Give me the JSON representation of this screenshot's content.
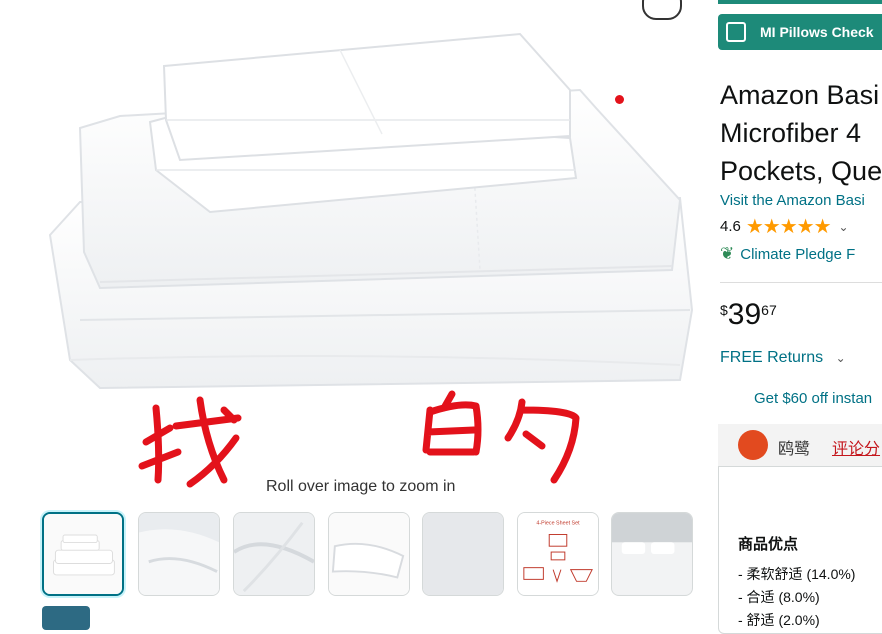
{
  "image": {
    "zoom_hint": "Roll over image to zoom in",
    "alt": "White microfiber sheet set folded and stacked"
  },
  "thumbnails": [
    {
      "label": "sheet-set-stack",
      "selected": true
    },
    {
      "label": "pillowcase-closeup",
      "selected": false
    },
    {
      "label": "sheet-texture",
      "selected": false
    },
    {
      "label": "pillow-side",
      "selected": false
    },
    {
      "label": "fabric-swatch",
      "selected": false
    },
    {
      "label": "4-piece-sheet-set-diagram",
      "selected": false
    },
    {
      "label": "bed-in-room",
      "selected": false
    }
  ],
  "thumb_text": {
    "diagram_title": "4-Piece Sheet Set"
  },
  "annotation": {
    "handwritten": "我 的",
    "color": "#e3121b"
  },
  "extension": {
    "button_label": "MI Pillows Check",
    "color": "#1d8a79"
  },
  "product": {
    "title_lines": [
      "Amazon Basi",
      "Microfiber 4",
      "Pockets, Que"
    ],
    "store_link": "Visit the Amazon Basi",
    "rating": "4.6",
    "climate_label": "Climate Pledge F",
    "price_symbol": "$",
    "price_whole": "39",
    "price_fraction": "67",
    "returns": "FREE Returns",
    "offer": "Get $60 off instan"
  },
  "review_panel": {
    "logo_name": "鸥鹭",
    "tab_label": "评论分",
    "pros_title": "商品优点",
    "pros": [
      "- 柔软舒适 (14.0%)",
      "- 合适 (8.0%)",
      "- 舒适 (2.0%)"
    ]
  },
  "icons": {
    "share": "share-icon",
    "star": "star-icon",
    "chevron": "chevron-down-icon",
    "climate": "climate-pledge-icon"
  }
}
